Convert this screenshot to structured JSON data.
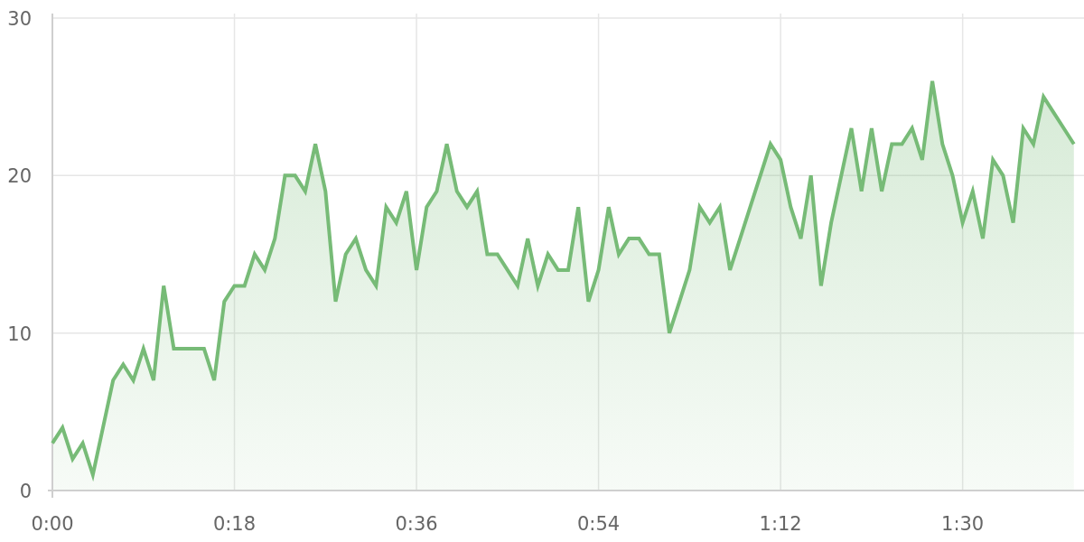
{
  "chart_data": {
    "type": "area",
    "grid": true,
    "x": [
      0,
      1,
      2,
      3,
      4,
      5,
      6,
      7,
      8,
      9,
      10,
      11,
      12,
      13,
      14,
      15,
      16,
      17,
      18,
      19,
      20,
      21,
      22,
      23,
      24,
      25,
      26,
      27,
      28,
      29,
      30,
      31,
      32,
      33,
      34,
      35,
      36,
      37,
      38,
      39,
      40,
      41,
      42,
      43,
      44,
      45,
      46,
      47,
      48,
      49,
      50,
      51,
      52,
      53,
      54,
      55,
      56,
      57,
      58,
      59,
      60,
      61,
      62,
      63,
      64,
      65,
      66,
      67,
      68,
      69,
      70,
      71,
      72,
      73,
      74,
      75,
      76,
      77,
      78,
      79,
      80,
      81,
      82,
      83,
      84,
      85,
      86,
      87,
      88,
      89,
      90,
      91,
      92,
      93,
      94,
      95,
      96,
      97,
      98,
      99,
      100,
      101
    ],
    "xlim": [
      0,
      102
    ],
    "ylim": [
      0,
      30
    ],
    "xticks": [
      {
        "value": 0,
        "label": "0:00"
      },
      {
        "value": 18,
        "label": "0:18"
      },
      {
        "value": 36,
        "label": "0:36"
      },
      {
        "value": 54,
        "label": "0:54"
      },
      {
        "value": 72,
        "label": "1:12"
      },
      {
        "value": 90,
        "label": "1:30"
      }
    ],
    "yticks": [
      0,
      10,
      20,
      30
    ],
    "series": [
      {
        "color": "#77bb77",
        "values": [
          3,
          4,
          2,
          3,
          1,
          4,
          7,
          8,
          7,
          9,
          7,
          13,
          9,
          9,
          9,
          9,
          7,
          12,
          13,
          13,
          15,
          14,
          16,
          20,
          20,
          19,
          22,
          19,
          12,
          15,
          16,
          14,
          13,
          18,
          17,
          19,
          14,
          18,
          19,
          22,
          19,
          18,
          19,
          15,
          15,
          14,
          13,
          16,
          13,
          15,
          14,
          14,
          18,
          12,
          14,
          18,
          15,
          16,
          16,
          15,
          15,
          10,
          12,
          14,
          18,
          17,
          18,
          14,
          16,
          18,
          20,
          22,
          21,
          18,
          16,
          20,
          13,
          17,
          20,
          23,
          19,
          23,
          19,
          22,
          22,
          23,
          21,
          26,
          22,
          20,
          17,
          19,
          16,
          21,
          20,
          17,
          23,
          22,
          25,
          24,
          23,
          22
        ]
      }
    ]
  }
}
